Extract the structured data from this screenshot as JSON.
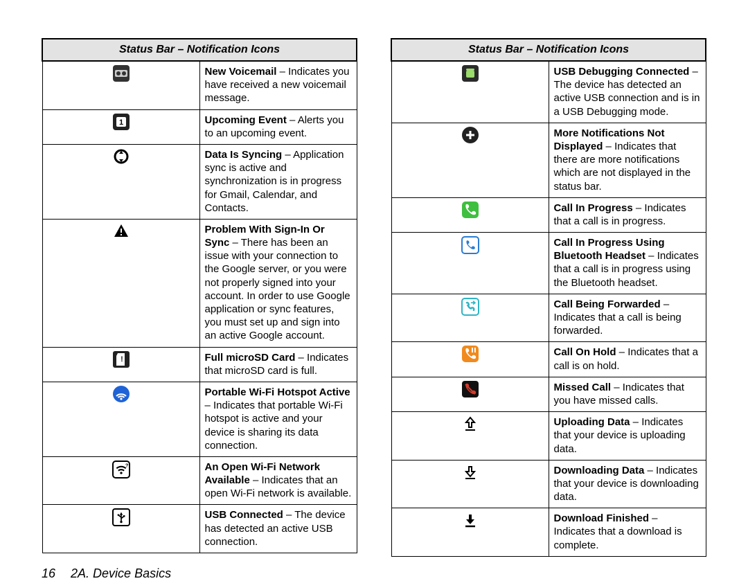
{
  "header_left": "Status Bar – Notification Icons",
  "header_right": "Status Bar – Notification Icons",
  "footer": {
    "page_number": "16",
    "section": "2A. Device Basics"
  },
  "left_rows": [
    {
      "icon": "voicemail-icon",
      "term": "New Voicemail",
      "sep": " – ",
      "desc": "Indicates you have received a new voicemail message."
    },
    {
      "icon": "upcoming-event-icon",
      "term": "Upcoming Event",
      "sep": " – ",
      "desc": "Alerts you to an upcoming event."
    },
    {
      "icon": "data-syncing-icon",
      "term": "Data Is Syncing",
      "sep": " – ",
      "desc": "Application sync is active and synchronization is in progress for Gmail, Calendar, and Contacts."
    },
    {
      "icon": "sync-problem-icon",
      "term": "Problem With Sign-In Or Sync",
      "sep": " – ",
      "desc": "There has been an issue with your connection to the Google server, or you were not properly signed into your account. In order to use Google application or sync features, you must set up and sign into an active Google account."
    },
    {
      "icon": "sd-full-icon",
      "term": "Full microSD Card",
      "sep": " – ",
      "desc": "Indicates that microSD card is full."
    },
    {
      "icon": "hotspot-icon",
      "term": "Portable Wi-Fi Hotspot Active",
      "sep": " – ",
      "desc": "Indicates that portable Wi-Fi hotspot is active and your device is sharing its data connection."
    },
    {
      "icon": "open-wifi-icon",
      "term": "An Open Wi-Fi Network Available",
      "sep": " – ",
      "desc": "Indicates that an open Wi-Fi network is available."
    },
    {
      "icon": "usb-connected-icon",
      "term": "USB Connected",
      "sep": " – ",
      "desc": "The device has detected an active USB connection."
    }
  ],
  "right_rows": [
    {
      "icon": "usb-debugging-icon",
      "term": "USB Debugging Connected",
      "sep": " – ",
      "desc": "The device has detected an active USB connection and is in a USB Debugging mode."
    },
    {
      "icon": "more-notifications-icon",
      "term": "More Notifications Not Displayed",
      "sep": " – ",
      "desc": "Indicates that there are more notifications which are not displayed in the status bar."
    },
    {
      "icon": "call-in-progress-icon",
      "term": "Call In Progress",
      "sep": " – ",
      "desc": "Indicates that a call is in progress."
    },
    {
      "icon": "call-bluetooth-icon",
      "term": "Call In Progress Using Bluetooth Headset",
      "sep": " – ",
      "desc": "Indicates that a call is in progress using the Bluetooth headset."
    },
    {
      "icon": "call-forwarded-icon",
      "term": "Call  Being Forwarded",
      "sep": " – ",
      "desc": "Indicates that a call is being forwarded."
    },
    {
      "icon": "call-on-hold-icon",
      "term": "Call  On Hold",
      "sep": " – ",
      "desc": "Indicates that a call is on hold."
    },
    {
      "icon": "missed-call-icon",
      "term": "Missed Call",
      "sep": " – ",
      "desc": "Indicates that you have missed calls."
    },
    {
      "icon": "uploading-icon",
      "term": "Uploading Data",
      "sep": " – ",
      "desc": "Indicates that your device is uploading data."
    },
    {
      "icon": "downloading-icon",
      "term": "Downloading Data",
      "sep": " – ",
      "desc": "Indicates that your device is downloading data."
    },
    {
      "icon": "download-finished-icon",
      "term": "Download Finished",
      "sep": " – ",
      "desc": "Indicates that a download is complete."
    }
  ]
}
